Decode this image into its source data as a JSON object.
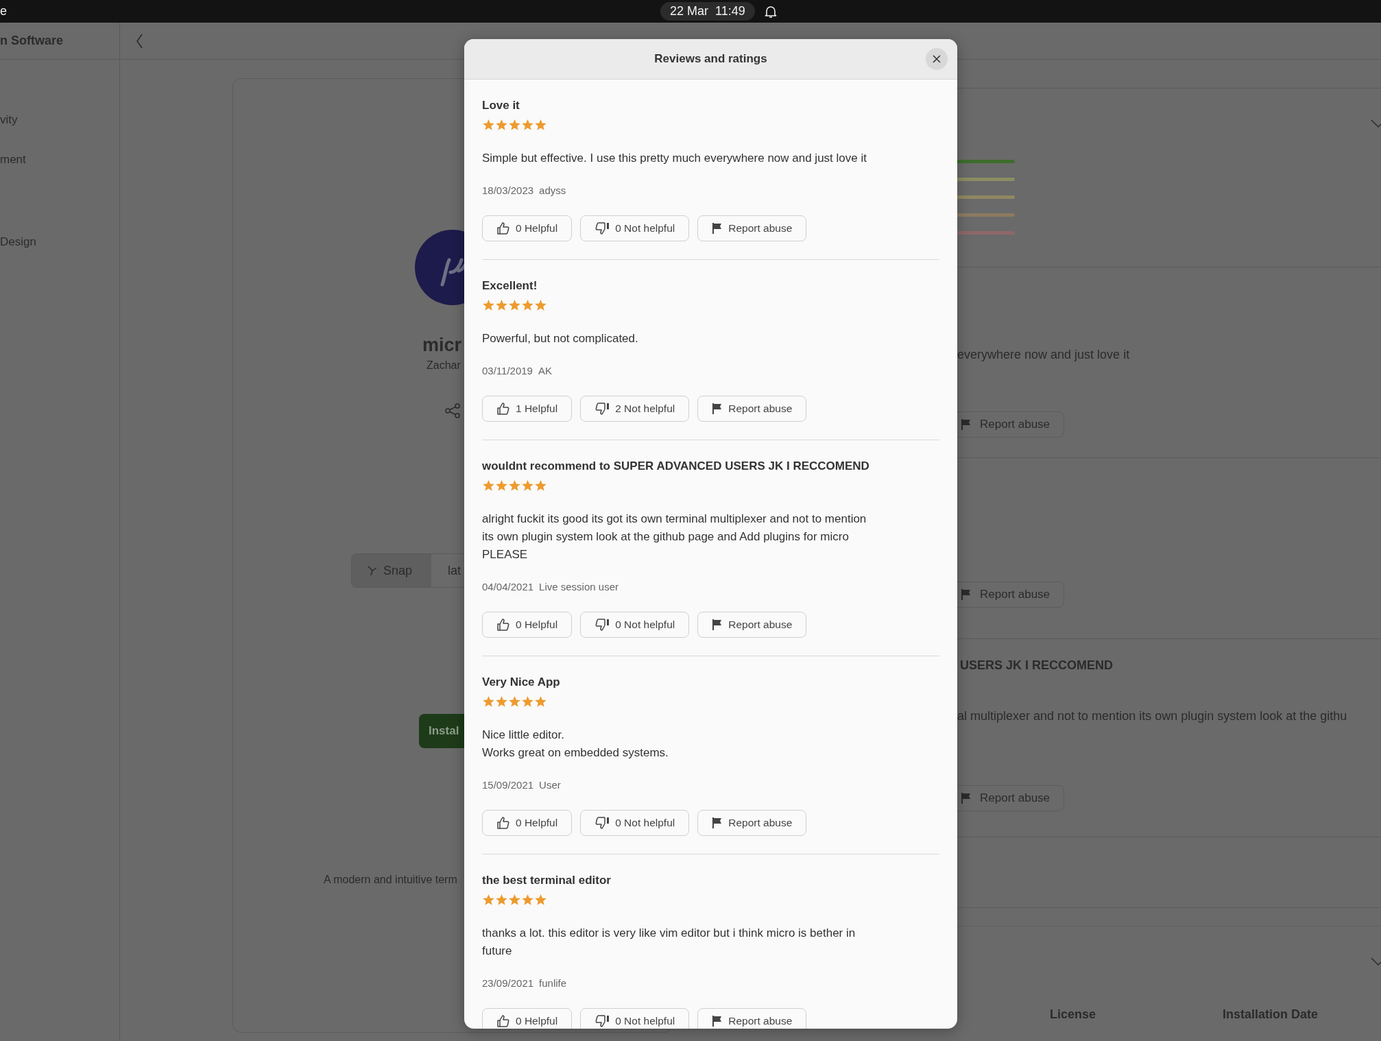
{
  "top_bar": {
    "app_name": "e",
    "clock": "22 Mar  11:49"
  },
  "sidebar": {
    "title": "n Software",
    "items": [
      {
        "label": "vity"
      },
      {
        "label": "ment"
      },
      {
        "label": "Design"
      }
    ]
  },
  "app_card": {
    "name": "micr",
    "developer": "Zachar",
    "sources": [
      {
        "label": "Snap",
        "selected": true
      },
      {
        "label": "lat",
        "selected": false
      }
    ],
    "install_button": "Instal",
    "summary": "A modern and intuitive term"
  },
  "details": {
    "rating_bars": [
      {
        "color": "#3d6e2c"
      },
      {
        "color": "#8b8d63"
      },
      {
        "color": "#908862"
      },
      {
        "color": "#8c7a60"
      },
      {
        "color": "#8f6769"
      }
    ],
    "fragments": [
      {
        "body": "everywhere now and just love it",
        "report": "Report abuse"
      },
      {
        "report": "Report abuse"
      },
      {
        "title": "USERS JK I RECCOMEND",
        "body": "al multiplexer and not to mention its own plugin system look at the githu",
        "report": "Report abuse"
      }
    ],
    "info_columns": [
      {
        "heading": "License"
      },
      {
        "heading": "Installation Date"
      }
    ]
  },
  "dialog": {
    "title": "Reviews and ratings",
    "reviews": [
      {
        "title": "Love it",
        "stars": 5,
        "body": "Simple but effective. I use this pretty much everywhere now and just love it",
        "date": "18/03/2023",
        "author": "adyss",
        "helpful": "0 Helpful",
        "not_helpful": "0 Not helpful",
        "report": "Report abuse"
      },
      {
        "title": "Excellent!",
        "stars": 5,
        "body": "Powerful, but not complicated.",
        "date": "03/11/2019",
        "author": "AK",
        "helpful": "1 Helpful",
        "not_helpful": "2 Not helpful",
        "report": "Report abuse"
      },
      {
        "title": "wouldnt recommend to SUPER ADVANCED USERS JK I RECCOMEND",
        "stars": 5,
        "body": "alright fuckit its good its got its own terminal multiplexer and not to mention\nits own plugin system look at the github page and Add plugins for micro\nPLEASE",
        "date": "04/04/2021",
        "author": "Live session user",
        "helpful": "0 Helpful",
        "not_helpful": "0 Not helpful",
        "report": "Report abuse"
      },
      {
        "title": "Very Nice App",
        "stars": 5,
        "body": "Nice little editor.\nWorks great on embedded systems.",
        "date": "15/09/2021",
        "author": "User",
        "helpful": "0 Helpful",
        "not_helpful": "0 Not helpful",
        "report": "Report abuse"
      },
      {
        "title": "the best terminal editor",
        "stars": 5,
        "body": "thanks a lot. this editor is very like vim editor but i think micro is bether in\nfuture",
        "date": "23/09/2021",
        "author": "funlife",
        "helpful": "0 Helpful",
        "not_helpful": "0 Not helpful",
        "report": "Report abuse"
      }
    ]
  }
}
